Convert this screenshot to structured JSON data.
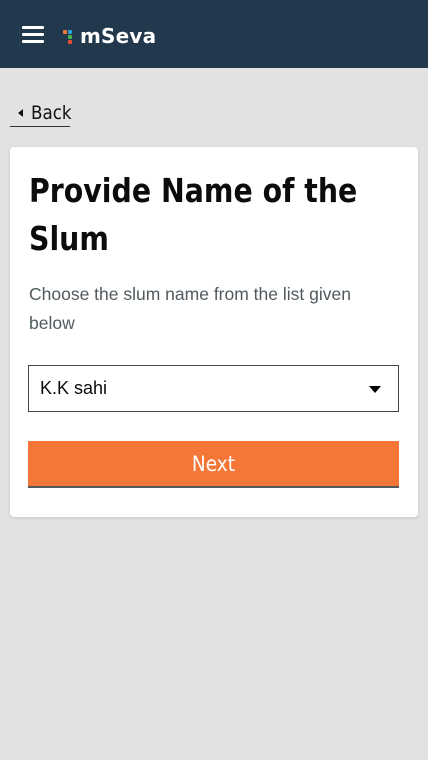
{
  "header": {
    "app_name": "mSeva",
    "menu_icon": "hamburger-menu-icon",
    "logo_dot_colors": [
      "#f47738",
      "#2ca4d8",
      "#44b549",
      "#e94e3a"
    ],
    "background_color": "#22394d"
  },
  "nav": {
    "back_label": "Back",
    "back_icon": "caret-left-icon"
  },
  "card": {
    "title": "Provide Name of the Slum",
    "subtitle": "Choose the slum name from the list given below"
  },
  "form": {
    "slum_select": {
      "selected_value": "K.K sahi",
      "icon": "caret-down-icon"
    },
    "next_label": "Next",
    "next_color": "#f47738"
  }
}
